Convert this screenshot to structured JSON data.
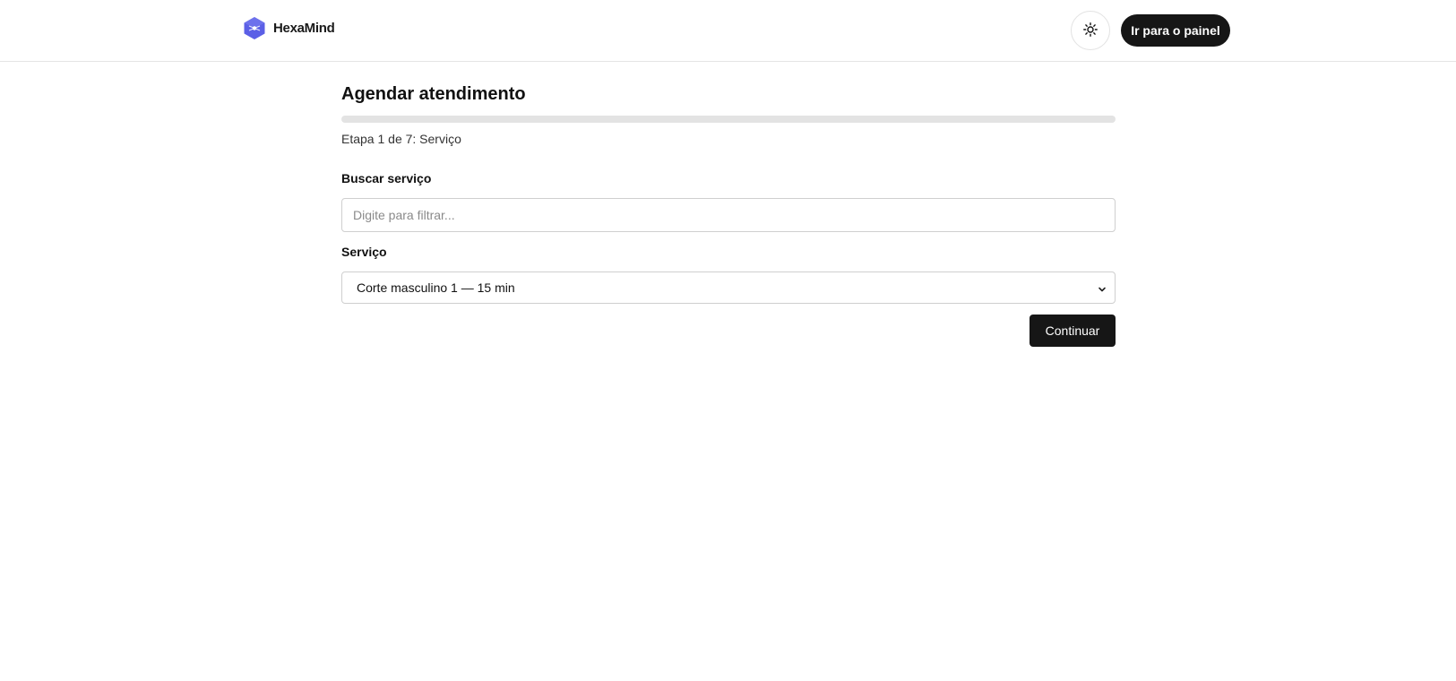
{
  "header": {
    "brand_name": "HexaMind",
    "brand_color": "#5b5fe6",
    "theme_toggle_icon": "sun-icon",
    "panel_button_label": "Ir para o painel"
  },
  "main": {
    "title": "Agendar atendimento",
    "progress": {
      "current_step": 1,
      "total_steps": 7,
      "fill_fraction": 0
    },
    "step_text": "Etapa 1 de 7: Serviço",
    "search": {
      "label": "Buscar serviço",
      "placeholder": "Digite para filtrar...",
      "value": ""
    },
    "service": {
      "label": "Serviço",
      "selected": "Corte masculino 1 — 15 min",
      "icon": "chevron-down-icon"
    },
    "continue_label": "Continuar"
  }
}
